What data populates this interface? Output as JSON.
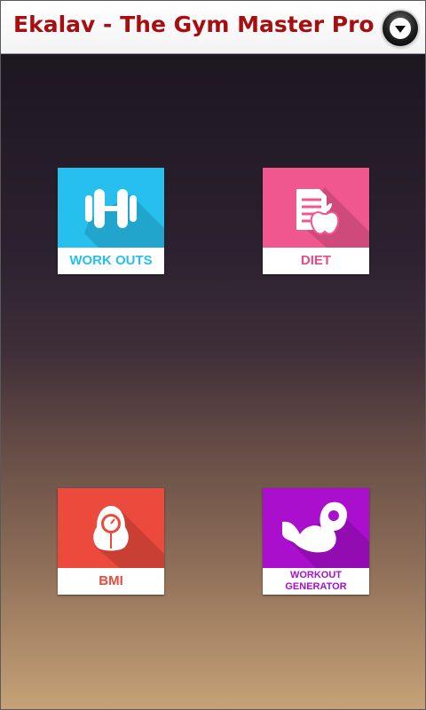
{
  "app": {
    "title": "Ekalav - The Gym Master Pro",
    "title_color": "#a50f12"
  },
  "menu_button": {
    "icon": "chevron-down-icon"
  },
  "tiles": [
    {
      "id": "workouts",
      "label": "WORK OUTS",
      "color": "#27c0ee",
      "label_color": "#27c0ee",
      "icon": "dumbbell-icon"
    },
    {
      "id": "diet",
      "label": "DIET",
      "color": "#f0578f",
      "label_color": "#e44c85",
      "icon": "diet-plan-apple-icon"
    },
    {
      "id": "bmi",
      "label": "BMI",
      "color": "#ec4a3c",
      "label_color": "#ec4a3c",
      "icon": "weighing-scale-icon"
    },
    {
      "id": "workout_generator",
      "label_line1": "WORKOUT",
      "label_line2": "GENERATOR",
      "color": "#aa0fce",
      "label_color": "#aa0fce",
      "icon": "flexed-arm-icon"
    }
  ]
}
